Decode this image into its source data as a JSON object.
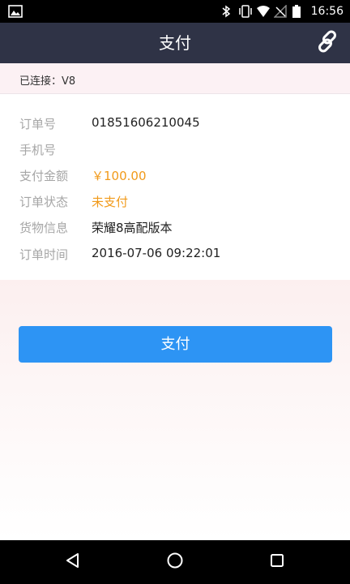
{
  "status_bar": {
    "time": "16:56",
    "icons": [
      "picture-icon",
      "bluetooth-icon",
      "vibrate-icon",
      "wifi-icon",
      "no-signal-icon",
      "battery-icon"
    ]
  },
  "app_bar": {
    "title": "支付",
    "action_icon": "link-icon"
  },
  "connection": {
    "text": "已连接：V8"
  },
  "order": {
    "rows": [
      {
        "label": "订单号",
        "value": "01851606210045"
      },
      {
        "label": "手机号",
        "value": ""
      },
      {
        "label": "支付金额",
        "value": "￥100.00"
      },
      {
        "label": "订单状态",
        "value": "未支付"
      },
      {
        "label": "货物信息",
        "value": "荣耀8高配版本"
      },
      {
        "label": "订单时间",
        "value": "2016-07-06 09:22:01"
      }
    ]
  },
  "pay_button": {
    "label": "支付"
  },
  "nav": {
    "icons": [
      "back-icon",
      "home-icon",
      "recents-icon"
    ]
  },
  "colors": {
    "app_bar": "#2f3346",
    "accent": "#2d94f4",
    "highlight": "#f19a1a",
    "connection_bg": "#fcf1f4"
  }
}
